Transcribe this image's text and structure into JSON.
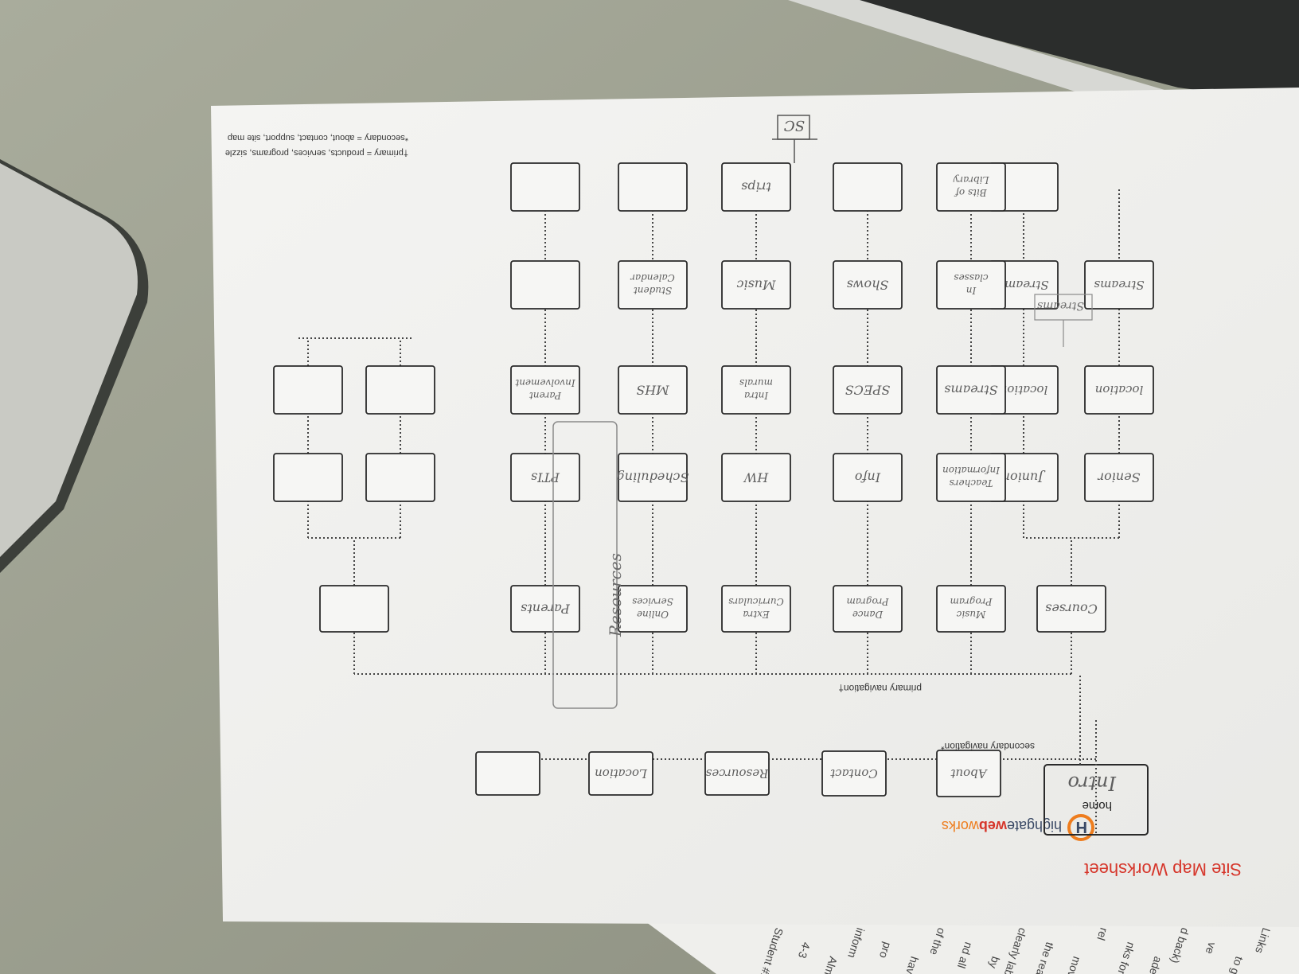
{
  "worksheet": {
    "title": "Site Map Worksheet",
    "brand": {
      "prefix": "highgate",
      "accent": "web",
      "suffix": "works"
    },
    "colors": {
      "title": "#d6362b",
      "brand_dark": "#3b4a66",
      "brand_orange": "#ee7d1e",
      "box_border": "#2a2a2a",
      "pencil": "#6a6a6a"
    },
    "footnotes": [
      "†primary = products, services, programs, sizzle",
      "*secondary = about, contact, support, site map"
    ],
    "labels": {
      "secondary": "secondary navigation*",
      "primary": "primary navigation†"
    },
    "home": {
      "printed": "home",
      "handwritten": "Intro"
    },
    "secondary_nav": [
      "About",
      "Contact",
      "Resources",
      "Location",
      ""
    ],
    "primary_nav": [
      {
        "label": "Courses",
        "children": [
          {
            "label": "Senior",
            "children": [
              "location",
              "Streams"
            ]
          },
          {
            "label": "Junior",
            "children": [
              "location",
              "Streams",
              ""
            ]
          }
        ]
      },
      {
        "label": "Music Program",
        "chain": [
          "Teachers Information",
          "Streams",
          "In classes",
          "Bits of Library"
        ]
      },
      {
        "label": "Dance Program",
        "chain": [
          "Info",
          "SPECS",
          "Shows",
          ""
        ]
      },
      {
        "label": "Extra Curriculars",
        "chain": [
          "HW",
          "Intra murals",
          "Music",
          "trips"
        ],
        "extra": "SC"
      },
      {
        "label": "Online Services",
        "chain": [
          "Scheduling",
          "MHS",
          "Student Calendar",
          ""
        ]
      },
      {
        "label": "Parents",
        "chain": [
          "PTIs",
          "Parent Involvement",
          "",
          ""
        ]
      },
      {
        "label": "",
        "children": [
          {
            "label": "",
            "children": [
              "",
              ""
            ]
          },
          {
            "label": "",
            "children": [
              "",
              ""
            ]
          }
        ]
      }
    ],
    "annotations": {
      "resources_group": "Resources",
      "streams_note": "Streams"
    }
  }
}
